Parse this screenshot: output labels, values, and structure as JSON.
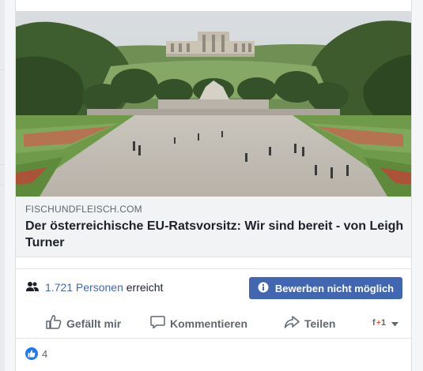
{
  "post": {
    "domain": "FISCHUNDFLEISCH.COM",
    "headline": "Der österreichische EU-Ratsvorsitz: Wir sind bereit - von Leigh Turner",
    "image_alt": "Schönbrunn Palace gardens with the Gloriette on the hill"
  },
  "insights": {
    "reach_count": "1.721 Personen",
    "reach_suffix": " erreicht",
    "boost_label": "Bewerben nicht möglich",
    "info_icon": "info-icon"
  },
  "actions": {
    "like_label": "Gefällt mir",
    "comment_label": "Kommentieren",
    "share_label": "Teilen"
  },
  "reactions": {
    "count": "4"
  },
  "colors": {
    "accent": "#4267b2",
    "like_blue": "#2078f4",
    "text_primary": "#1d2129",
    "text_secondary": "#606770"
  }
}
